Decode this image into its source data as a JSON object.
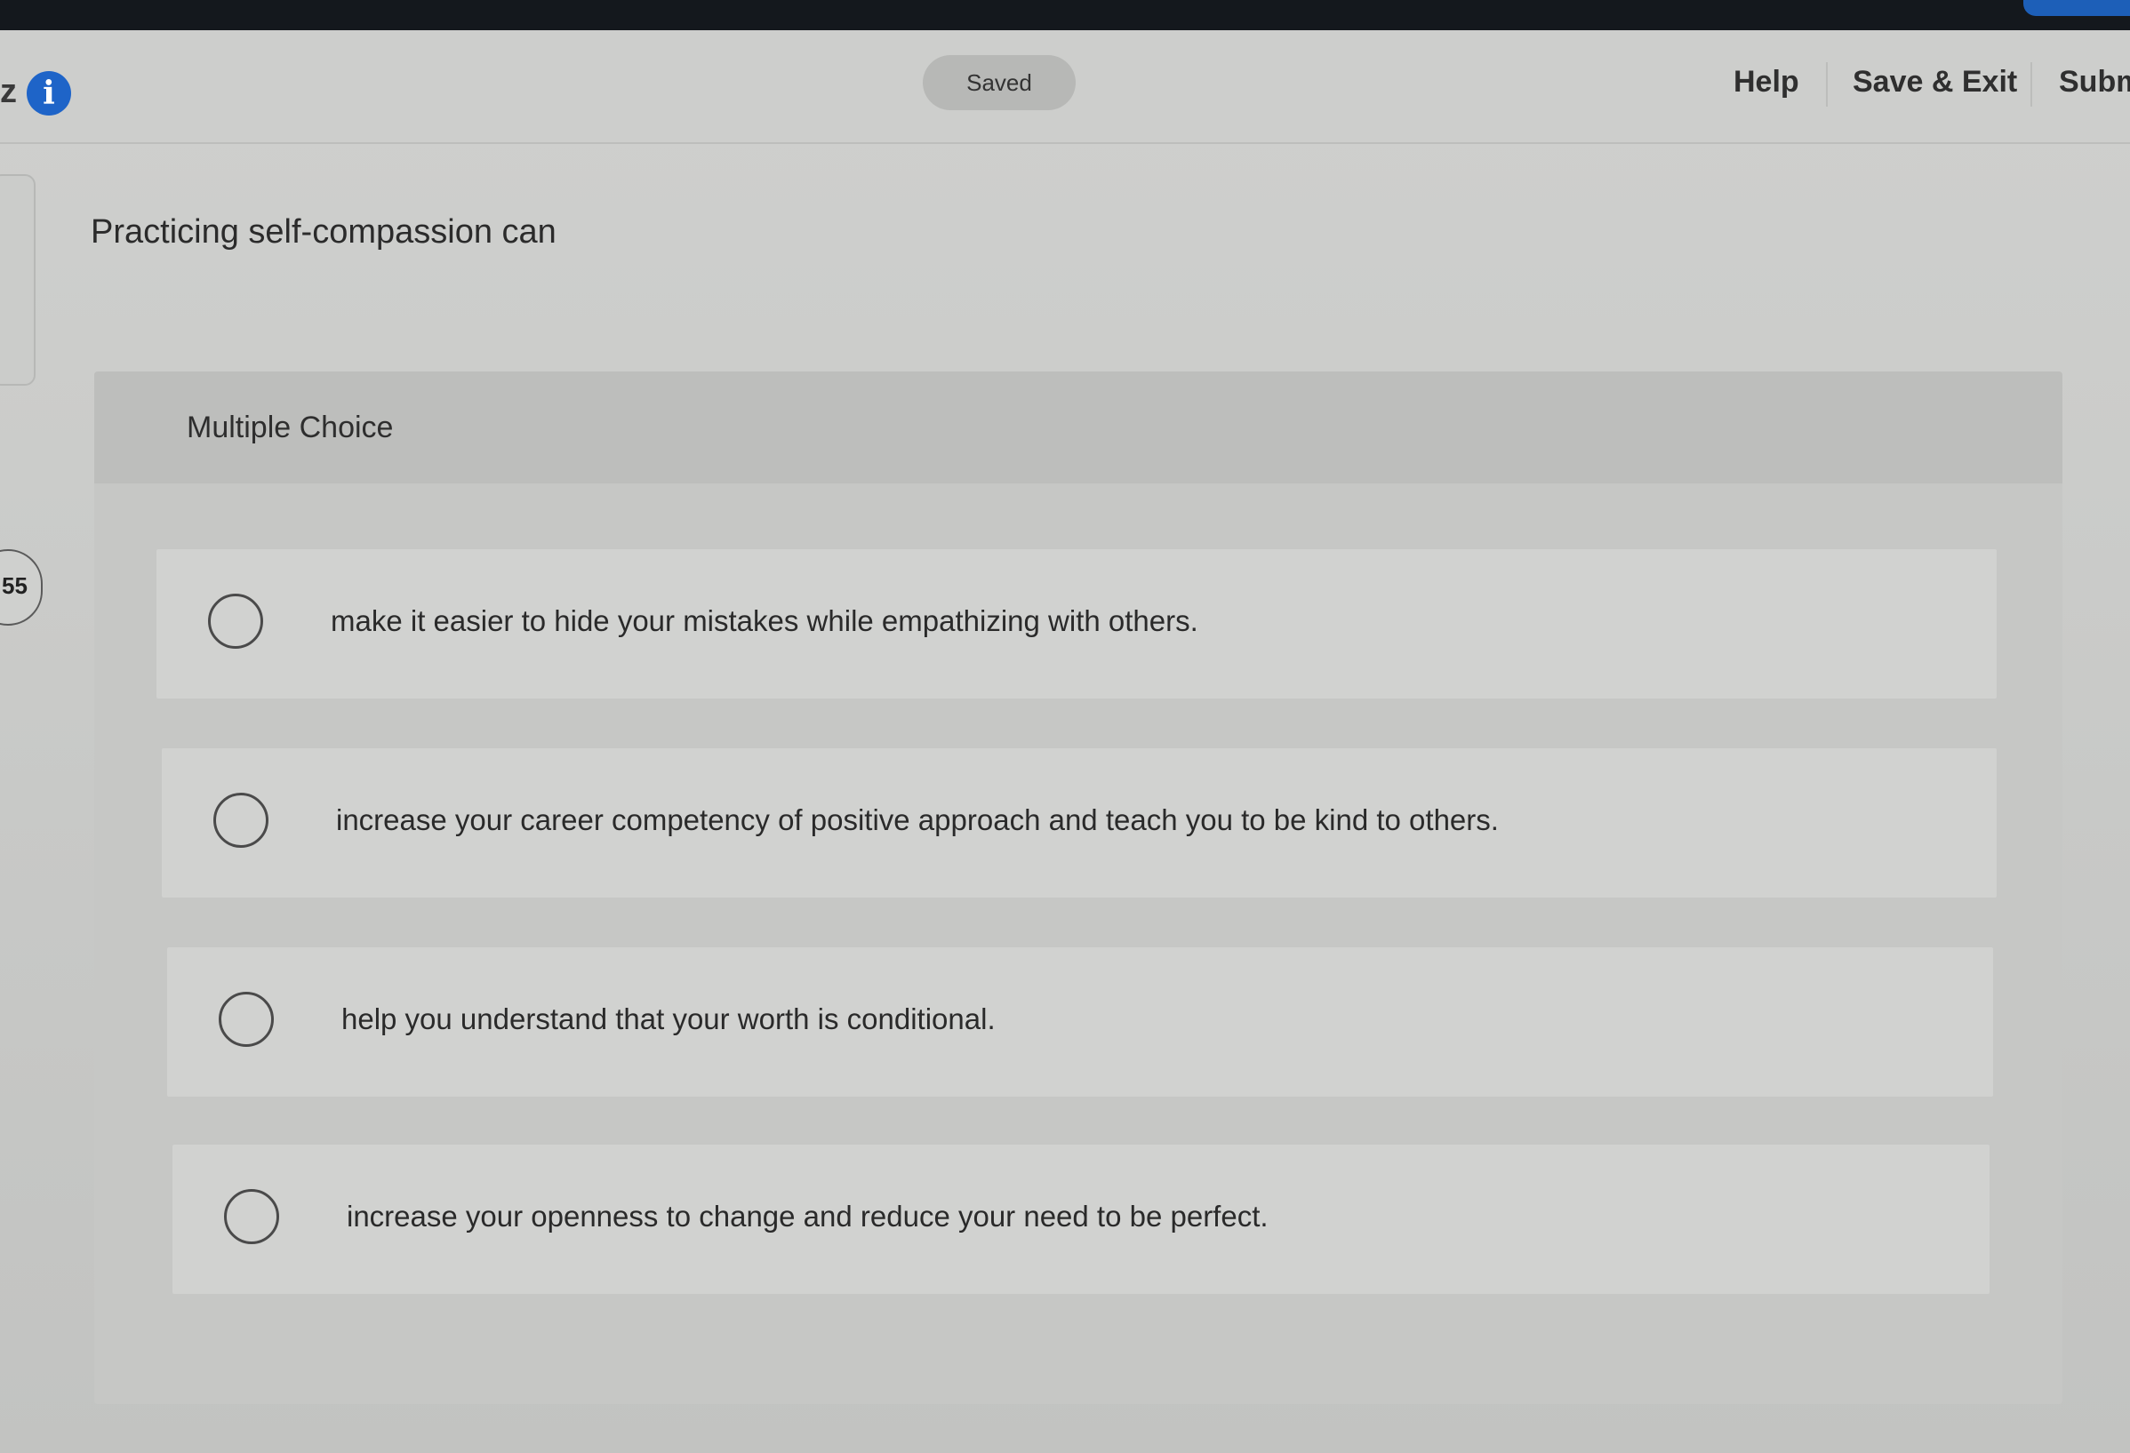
{
  "header": {
    "edge_letter": "z",
    "saved_label": "Saved",
    "help_label": "Help",
    "save_exit_label": "Save & Exit",
    "submit_label": "Subm"
  },
  "sidebar": {
    "badge": "55"
  },
  "question": {
    "prompt": "Practicing self-compassion can",
    "type_label": "Multiple Choice",
    "options": [
      {
        "label": "make it easier to hide your mistakes while empathizing with others."
      },
      {
        "label": "increase your career competency of positive approach and teach you to be kind to others."
      },
      {
        "label": "help you understand that your worth is conditional."
      },
      {
        "label": "increase your openness to change and reduce your need to be perfect."
      }
    ]
  },
  "colors": {
    "info_icon": "#1e64c8",
    "accent_tab": "#1d5fb8"
  }
}
